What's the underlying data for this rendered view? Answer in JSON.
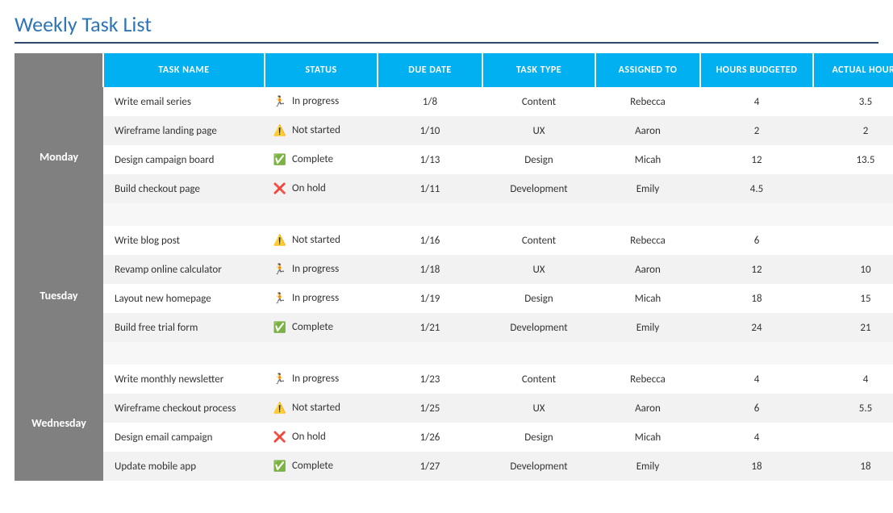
{
  "title": "Weekly Task List",
  "headers": {
    "day": "",
    "task_name": "TASK NAME",
    "status": "STATUS",
    "due_date": "DUE DATE",
    "task_type": "TASK TYPE",
    "assigned_to": "ASSIGNED TO",
    "hours_budgeted": "HOURS BUDGETED",
    "actual_hours": "ACTUAL HOURS"
  },
  "status_labels": {
    "in_progress": "In progress",
    "not_started": "Not started",
    "complete": "Complete",
    "on_hold": "On hold"
  },
  "status_icons": {
    "in_progress": "🏃",
    "not_started": "⚠️",
    "complete": "✅",
    "on_hold": "❌"
  },
  "days": [
    {
      "name": "Monday",
      "tasks": [
        {
          "task_name": "Write email series",
          "status": "in_progress",
          "due_date": "1/8",
          "task_type": "Content",
          "assigned_to": "Rebecca",
          "hours_budgeted": "4",
          "actual_hours": "3.5"
        },
        {
          "task_name": "Wireframe landing page",
          "status": "not_started",
          "due_date": "1/10",
          "task_type": "UX",
          "assigned_to": "Aaron",
          "hours_budgeted": "2",
          "actual_hours": "2"
        },
        {
          "task_name": "Design campaign board",
          "status": "complete",
          "due_date": "1/13",
          "task_type": "Design",
          "assigned_to": "Micah",
          "hours_budgeted": "12",
          "actual_hours": "13.5"
        },
        {
          "task_name": "Build checkout page",
          "status": "on_hold",
          "due_date": "1/11",
          "task_type": "Development",
          "assigned_to": "Emily",
          "hours_budgeted": "4.5",
          "actual_hours": ""
        }
      ]
    },
    {
      "name": "Tuesday",
      "tasks": [
        {
          "task_name": "Write blog post",
          "status": "not_started",
          "due_date": "1/16",
          "task_type": "Content",
          "assigned_to": "Rebecca",
          "hours_budgeted": "6",
          "actual_hours": ""
        },
        {
          "task_name": "Revamp online calculator",
          "status": "in_progress",
          "due_date": "1/18",
          "task_type": "UX",
          "assigned_to": "Aaron",
          "hours_budgeted": "12",
          "actual_hours": "10"
        },
        {
          "task_name": "Layout new homepage",
          "status": "in_progress",
          "due_date": "1/19",
          "task_type": "Design",
          "assigned_to": "Micah",
          "hours_budgeted": "18",
          "actual_hours": "15"
        },
        {
          "task_name": "Build free trial form",
          "status": "complete",
          "due_date": "1/21",
          "task_type": "Development",
          "assigned_to": "Emily",
          "hours_budgeted": "24",
          "actual_hours": "21"
        }
      ]
    },
    {
      "name": "Wednesday",
      "tasks": [
        {
          "task_name": "Write monthly newsletter",
          "status": "in_progress",
          "due_date": "1/23",
          "task_type": "Content",
          "assigned_to": "Rebecca",
          "hours_budgeted": "4",
          "actual_hours": "4"
        },
        {
          "task_name": "Wireframe checkout process",
          "status": "not_started",
          "due_date": "1/25",
          "task_type": "UX",
          "assigned_to": "Aaron",
          "hours_budgeted": "6",
          "actual_hours": "5.5"
        },
        {
          "task_name": "Design email campaign",
          "status": "on_hold",
          "due_date": "1/26",
          "task_type": "Design",
          "assigned_to": "Micah",
          "hours_budgeted": "4",
          "actual_hours": ""
        },
        {
          "task_name": "Update mobile app",
          "status": "complete",
          "due_date": "1/27",
          "task_type": "Development",
          "assigned_to": "Emily",
          "hours_budgeted": "18",
          "actual_hours": "18"
        }
      ]
    }
  ]
}
